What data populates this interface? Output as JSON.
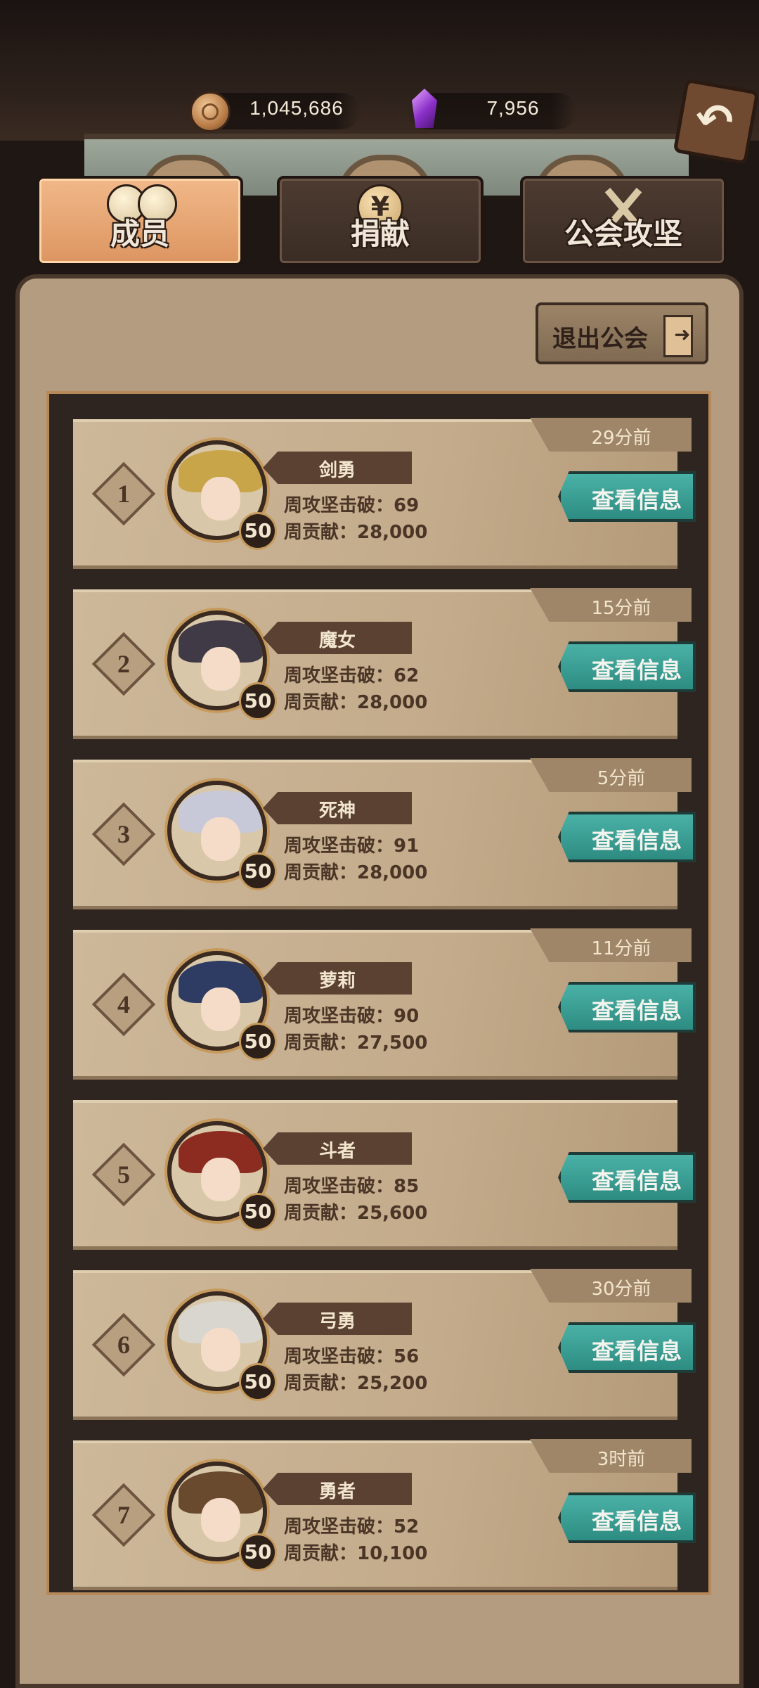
{
  "currencies": {
    "gold": {
      "value": "1,045,686",
      "icon": "coin-icon"
    },
    "gems": {
      "value": "7,956",
      "icon": "gem-icon"
    }
  },
  "tabs": [
    {
      "label": "成员",
      "active": true,
      "icon": "members-icon"
    },
    {
      "label": "捐献",
      "active": false,
      "icon": "donate-coin-icon",
      "glyph": "¥"
    },
    {
      "label": "公会攻坚",
      "active": false,
      "icon": "crossed-swords-icon"
    }
  ],
  "back_glyph": "↶",
  "quit_button": {
    "label": "退出公会",
    "icon": "exit-door-icon"
  },
  "members": [
    {
      "rank": "1",
      "name": "剑勇",
      "level": "50",
      "siege": "周攻坚击破：69",
      "contribution": "周贡献：28,000",
      "last_seen": "29分前",
      "button": "查看信息"
    },
    {
      "rank": "2",
      "name": "魔女",
      "level": "50",
      "siege": "周攻坚击破：62",
      "contribution": "周贡献：28,000",
      "last_seen": "15分前",
      "button": "查看信息"
    },
    {
      "rank": "3",
      "name": "死神",
      "level": "50",
      "siege": "周攻坚击破：91",
      "contribution": "周贡献：28,000",
      "last_seen": "5分前",
      "button": "查看信息"
    },
    {
      "rank": "4",
      "name": "萝莉",
      "level": "50",
      "siege": "周攻坚击破：90",
      "contribution": "周贡献：27,500",
      "last_seen": "11分前",
      "button": "查看信息"
    },
    {
      "rank": "5",
      "name": "斗者",
      "level": "50",
      "siege": "周攻坚击破：85",
      "contribution": "周贡献：25,600",
      "last_seen": "",
      "button": "查看信息"
    },
    {
      "rank": "6",
      "name": "弓勇",
      "level": "50",
      "siege": "周攻坚击破：56",
      "contribution": "周贡献：25,200",
      "last_seen": "30分前",
      "button": "查看信息"
    },
    {
      "rank": "7",
      "name": "勇者",
      "level": "50",
      "siege": "周攻坚击破：52",
      "contribution": "周贡献：10,100",
      "last_seen": "3时前",
      "button": "查看信息"
    }
  ],
  "colors": {
    "accent_teal": "#3aa095",
    "panel": "#b49c81",
    "tab_active": "#e7a672"
  }
}
